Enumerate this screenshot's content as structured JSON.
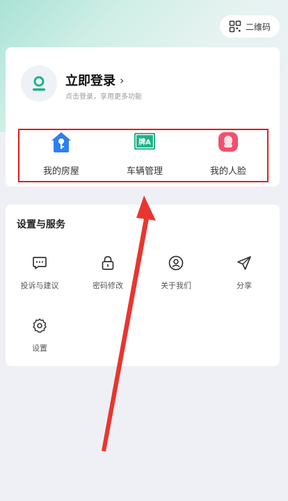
{
  "header": {
    "qr_label": "二维码"
  },
  "profile": {
    "login_title": "立即登录",
    "login_chevron": "›",
    "login_subtitle": "点击登录，享用更多功能"
  },
  "quick_actions": [
    {
      "label": "我的房屋",
      "icon": "house-key-icon",
      "color": "#2f7ff2"
    },
    {
      "label": "车辆管理",
      "icon": "license-plate-icon",
      "color": "#1fb28a",
      "badge": "牌A"
    },
    {
      "label": "我的人脸",
      "icon": "face-icon",
      "color": "#f0506e"
    }
  ],
  "services": {
    "title": "设置与服务",
    "items": [
      {
        "label": "投诉与建议",
        "icon": "message-icon"
      },
      {
        "label": "密码修改",
        "icon": "lock-icon"
      },
      {
        "label": "关于我们",
        "icon": "user-circle-icon"
      },
      {
        "label": "分享",
        "icon": "send-icon"
      },
      {
        "label": "设置",
        "icon": "gear-icon"
      }
    ]
  },
  "colors": {
    "accent": "#1fb28a",
    "highlight_border": "#e21b1b",
    "arrow": "#e8362f"
  }
}
